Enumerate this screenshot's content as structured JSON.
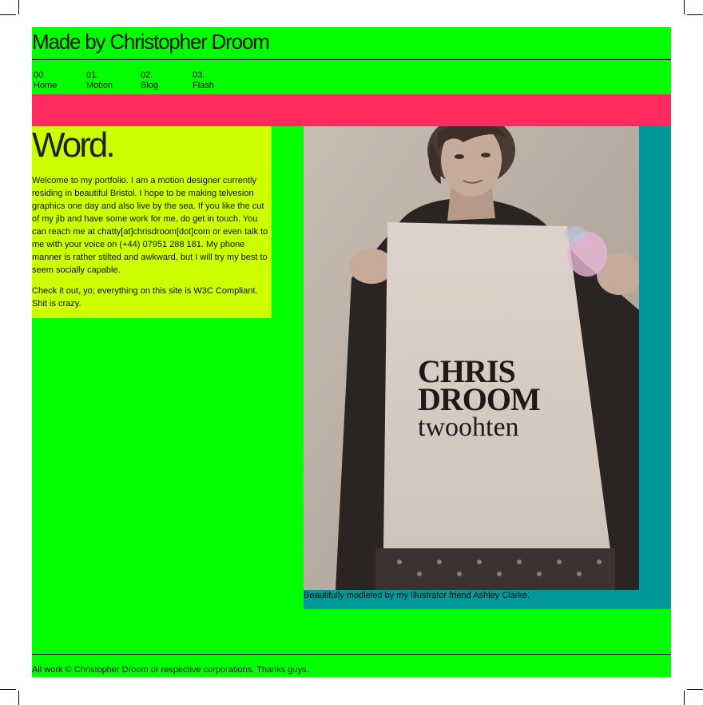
{
  "header": {
    "title": "Made by Christopher Droom"
  },
  "nav": {
    "items": [
      {
        "num": "00.",
        "label": "Home"
      },
      {
        "num": "01.",
        "label": "Motion"
      },
      {
        "num": "02.",
        "label": "Blog"
      },
      {
        "num": "03.",
        "label": "Flash"
      }
    ]
  },
  "intro": {
    "heading": "Word.",
    "paragraph1": "Welcome to my portfolio. I am a motion designer currently residing in beautiful Bristol. I hope to be making telvesion graphics one day and also live by the sea. If you like the cut of my jib and have some work for me, do get in touch. You can reach me at chatty[at]chrisdroom[dot]com or even talk to me with your voice on (+44) 07951 288 181. My phone manner is rather stilted and awkward, but I will try my best to seem socially capable.",
    "paragraph2": "Check it out, yo; everything on this site is W3C Compliant. Shit is crazy."
  },
  "photo": {
    "poster_line1": "CHRIS",
    "poster_line2": "DROOM",
    "poster_line3": "twoohten",
    "caption_text": "Beautifully modleled by my Illustrator friend ",
    "caption_link": "Ashley Clarke",
    "caption_end": "."
  },
  "footer": {
    "text": "All work © Christopher Droom or respective corporations. Thanks guys."
  },
  "colors": {
    "page_bg": "#00ff00",
    "band": "#ff2b5e",
    "intro_bg": "#ccff00",
    "photo_frame": "#009999"
  }
}
